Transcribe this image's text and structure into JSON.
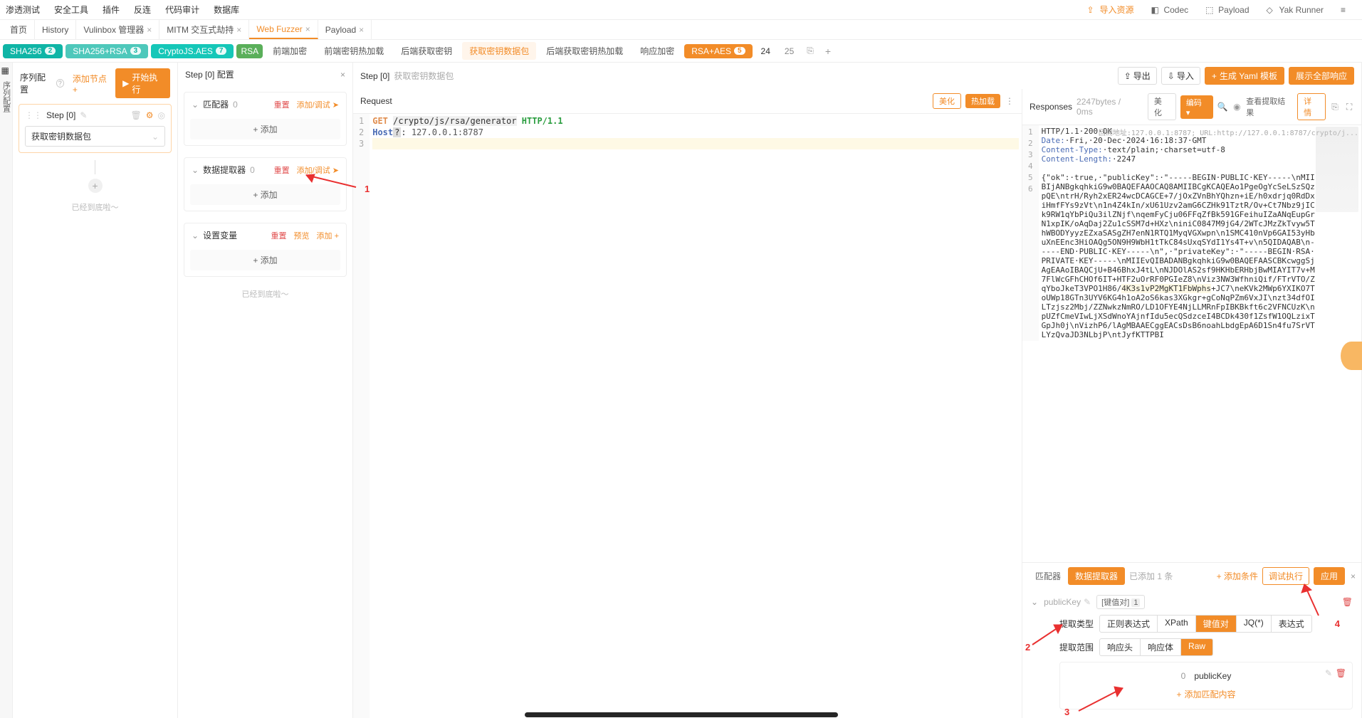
{
  "top_menu": {
    "items": [
      "渗透测试",
      "安全工具",
      "插件",
      "反连",
      "代码审计",
      "数据库"
    ],
    "right": {
      "import": "导入资源",
      "codec": "Codec",
      "payload": "Payload",
      "runner": "Yak Runner"
    }
  },
  "secondary_tabs": [
    {
      "label": "首页",
      "closable": false
    },
    {
      "label": "History",
      "closable": false
    },
    {
      "label": "Vulinbox 管理器",
      "closable": true
    },
    {
      "label": "MITM 交互式劫持",
      "closable": true
    },
    {
      "label": "Web Fuzzer",
      "closable": true,
      "active": true
    },
    {
      "label": "Payload",
      "closable": true
    }
  ],
  "pill_tabs": {
    "pills": [
      {
        "label": "SHA256",
        "badge": "2",
        "cls": "teal"
      },
      {
        "label": "SHA256+RSA",
        "badge": "3",
        "cls": "teal-light"
      },
      {
        "label": "CryptoJS.AES",
        "badge": "7",
        "cls": "teal-bright"
      },
      {
        "label": "RSA",
        "badge": "",
        "cls": "green"
      }
    ],
    "plain": [
      {
        "label": "前端加密"
      },
      {
        "label": "前端密钥热加载"
      },
      {
        "label": "后端获取密钥"
      },
      {
        "label": "获取密钥数据包",
        "active": true
      },
      {
        "label": "后端获取密钥热加载"
      },
      {
        "label": "响应加密"
      }
    ],
    "rsa_aes": {
      "label": "RSA+AES",
      "badge": "5"
    },
    "pages": [
      "24",
      "25"
    ]
  },
  "seq_col": {
    "title": "序列配置",
    "add_node": "添加节点 +",
    "start": "开始执行",
    "step_label": "Step [0]",
    "select_label": "获取密钥数据包",
    "bottom_note": "已经到底啦～"
  },
  "step_config": {
    "title": "Step [0] 配置",
    "blocks": [
      {
        "title": "匹配器",
        "count": "0",
        "actions": [
          "重置",
          "添加/调试 ➤"
        ],
        "add": "添加"
      },
      {
        "title": "数据提取器",
        "count": "0",
        "actions": [
          "重置",
          "添加/调试 ➤"
        ],
        "add": "添加"
      },
      {
        "title": "设置变量",
        "count": "",
        "actions": [
          "重置",
          "预览",
          "添加 +"
        ],
        "add": "添加"
      }
    ],
    "bottom_note": "已经到底啦～"
  },
  "annotations": {
    "a1": "1",
    "a2": "2",
    "a3": "3",
    "a4": "4"
  },
  "request_panel": {
    "step_title": "Step [0]",
    "subtitle": "获取密钥数据包",
    "request_label": "Request",
    "beautify": "美化",
    "hotload": "热加载",
    "export": "导出",
    "import": "导入",
    "gen_yaml": "生成 Yaml 模板",
    "show_all": "展示全部响应",
    "code": {
      "method": "GET",
      "path": "/crypto/js/rsa/generator",
      "proto": "HTTP/1.1",
      "host_key": "Host",
      "host_val": "127.0.0.1:8787"
    }
  },
  "response_panel": {
    "label": "Responses",
    "meta": "2247bytes / 0ms",
    "beautify": "美化",
    "encode": "编码",
    "view_result": "查看提取结果",
    "detail": "详情",
    "back_addr_label": "回溯地址:",
    "back_addr_val": "127.0.0.1:8787; URL:http://127.0.0.1:8787/crypto/j...",
    "lines": {
      "l1": "HTTP/1.1·200·OK",
      "l2k": "Date:",
      "l2v": "·Fri,·20·Dec·2024·16:18:37·GMT",
      "l3k": "Content-Type:",
      "l3v": "·text/plain;·charset=utf-8",
      "l4k": "Content-Length:",
      "l4v": "·2247",
      "l6a": "{\"ok\":·true,·\"publicKey\":·\"-----BEGIN·PUBLIC·KEY-----\\nMIIBIjANBgkqhkiG9w0BAQEFAAOCAQ8AMIIBCgKCAQEAo1PgeOgYcSeLSzSQzpQE\\ntrH/Ryh2xER24wcDCAGCE+7/jOxZVnBhYQhzn+iE/h0xdrjq0RdDxiHmfFYs9zVt\\n1n4Z4kIn/xU61Uzv2amG6CZHk91TztR/Ov+Ct7Nbz9jICk9RW1qYbPiQu3ilZNjf\\nqemFyCju06FFqZfBk591GFeihuIZaANqEupGrN1xpIK/oAqDaj2Zu1cSSM7d+HXz\\niniC0847M9jG4/2WTcJMzZkTvyw5ThWBODYyyzEZxaSASgZH7enN1RTQ1MyqVGXwpn\\n1SMC410nVp6GAI53yHbuXnEEnc3HiOAQg5ON9H9WbH1tTkC84sUxqSYdI1Ys4T+v\\n5QIDAQAB\\n-----END·PUBLIC·KEY-----\\n\",·\"privateKey\":·\"-----BEGIN·RSA·PRIVATE·KEY-----\\nMIIEvQIBADANBgkqhkiG9w0BAQEFAASCBKcwggSjAgEAAoIBAQCjU+B46BhxJ4tL\\nNJDOlAS2sf9HKHbERHbjBwMIAYIT7v+M7FlWcGFhCHOf6IT+HTF2uOrRF0PGIeZ8\\nViz3NW3WfhniQif/FTrVTO/ZqYboJkeT3VPO1H86/",
      "l6hl": "4K3s1vP2MgKT1FbWphs",
      "l6b": "+JC7\\neKVk2MWp6YXIKO7ToUWp18GTn3UYV6KG4h1oA2oS6kas3XGkgr+gCoNqPZm6VxJI\\nzt34dfOILTzjsz2Mbj/ZZNwkzNmRO/LD1OFYE4NjLLMRnFpIBKBkft6c2VFNCUzK\\npUZfCmeVIwLjXSdWnoYAjnfIdu5ecQSdzceI4BCDk430f1ZsfW1OQLzixTGpJh0j\\nVizhP6/lAgMBAAECggEACsDsB6noahLbdgEpA6D1Sn4fu7SrVTLYzQvaJD3NLbjP\\ntJyfKTTPBI"
    }
  },
  "extract_panel": {
    "tabs": {
      "matcher": "匹配器",
      "extractor": "数据提取器"
    },
    "meta": "已添加 1 条",
    "add_cond": "添加条件",
    "debug": "调试执行",
    "apply": "应用",
    "name": "publicKey",
    "kind_tag": "[键值对]",
    "kind_count": "1",
    "type_label": "提取类型",
    "types": [
      "正则表达式",
      "XPath",
      "键值对",
      "JQ(*)",
      "表达式"
    ],
    "scope_label": "提取范围",
    "scopes": [
      "响应头",
      "响应体",
      "Raw"
    ],
    "item_index": "0",
    "item_value": "publicKey",
    "add_match": "添加匹配内容"
  }
}
